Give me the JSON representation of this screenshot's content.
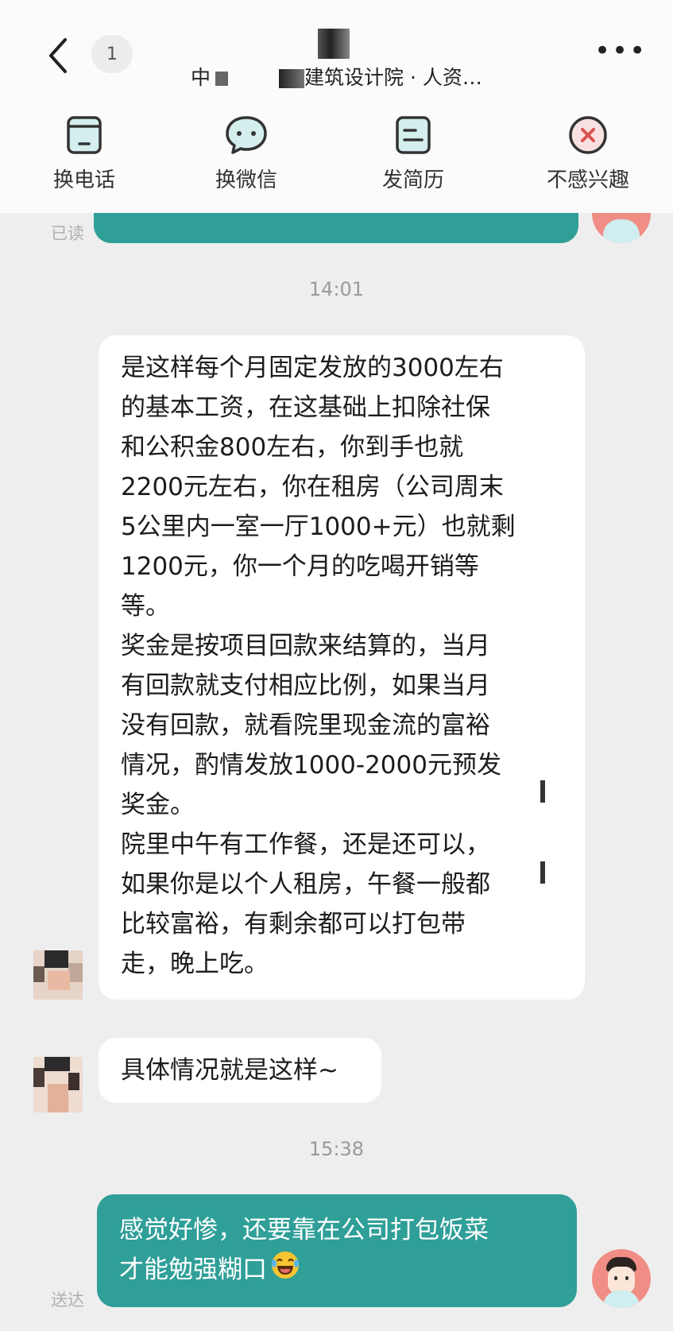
{
  "header": {
    "title_prefix": "中",
    "title_suffix": "建筑设计院 · 人资…",
    "unread_badge": "1",
    "more_label": "•••"
  },
  "actions": [
    {
      "label": "换电话",
      "icon": "phone-card-icon"
    },
    {
      "label": "换微信",
      "icon": "wechat-icon"
    },
    {
      "label": "发简历",
      "icon": "resume-icon"
    },
    {
      "label": "不感兴趣",
      "icon": "close-circle-icon"
    }
  ],
  "chat": {
    "read_status_top": "已读",
    "time_1": "14:01",
    "message_long": [
      "是这样每个月固定发放的3000左右",
      "的基本工资，在这基础上扣除社保",
      "和公积金800左右，你到手也就",
      "2200元左右，你在租房（公司周末",
      "5公里内一室一厅1000+元）也就剩",
      "1200元，你一个月的吃喝开销等",
      "等。",
      "奖金是按项目回款来结算的，当月",
      "有回款就支付相应比例，如果当月",
      "没有回款，就看院里现金流的富裕",
      "情况，酌情发放1000-2000元预发",
      "奖金。",
      "院里中午有工作餐，还是还可以，",
      "如果你是以个人租房，午餐一般都",
      "比较富裕，有剩余都可以打包带",
      "走，晚上吃。"
    ],
    "message_short": "具体情况就是这样~",
    "time_2": "15:38",
    "my_message": [
      "感觉好惨，还要靠在公司打包饭菜",
      "才能勉强糊口"
    ],
    "my_emoji": "😂",
    "sent_status": "送达"
  },
  "colors": {
    "accent": "#2f9f98",
    "background": "#eeeeee",
    "header_bg": "#fbfbfb",
    "dislike_red": "#d9534f"
  }
}
